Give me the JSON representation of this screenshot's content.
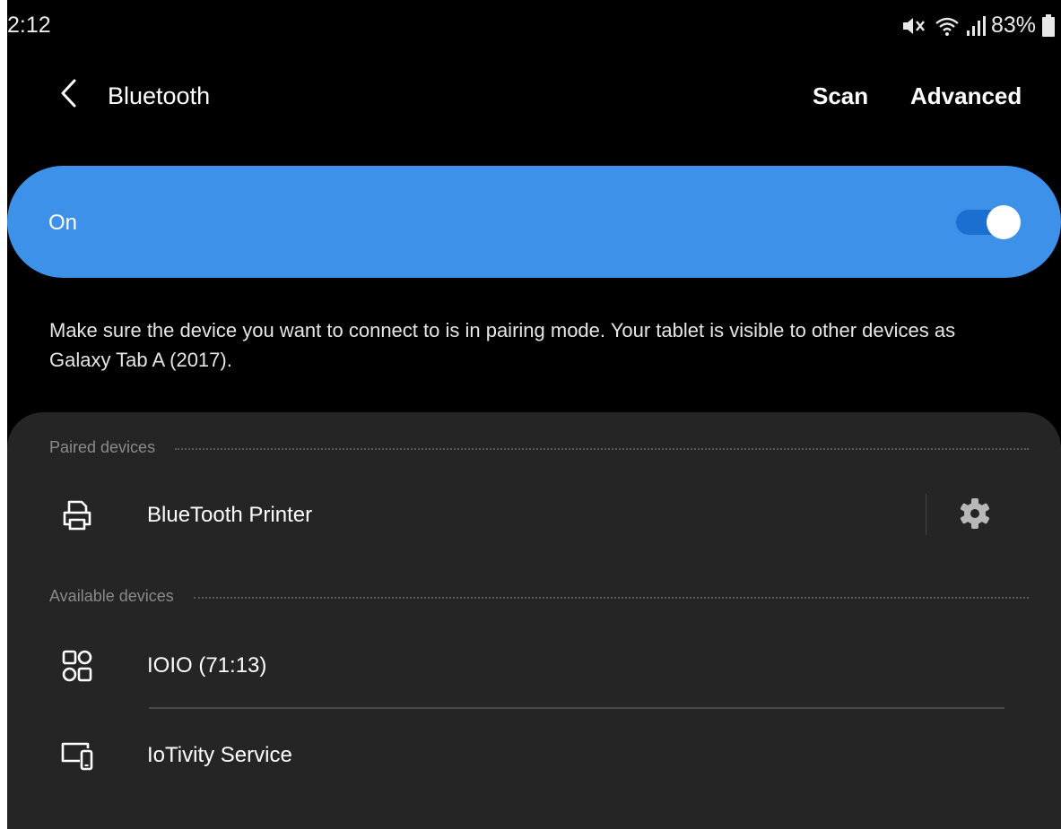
{
  "status_bar": {
    "time": "2:12",
    "battery_percent": "83%",
    "icons": [
      "mute-icon",
      "wifi-icon",
      "signal-icon",
      "battery-icon"
    ]
  },
  "header": {
    "title": "Bluetooth",
    "scan_label": "Scan",
    "advanced_label": "Advanced"
  },
  "master_toggle": {
    "label": "On",
    "enabled": true,
    "accent_color": "#3e91e8"
  },
  "description": "Make sure the device you want to connect to is in pairing mode. Your tablet is visible to other devices as Galaxy Tab A (2017).",
  "sections": {
    "paired": {
      "label": "Paired devices",
      "devices": [
        {
          "name": "BlueTooth Printer",
          "icon": "printer-icon"
        }
      ]
    },
    "available": {
      "label": "Available devices",
      "devices": [
        {
          "name": "IOIO (71:13)",
          "icon": "generic-device-icon"
        },
        {
          "name": "IoTivity Service",
          "icon": "devices-icon"
        }
      ]
    }
  }
}
